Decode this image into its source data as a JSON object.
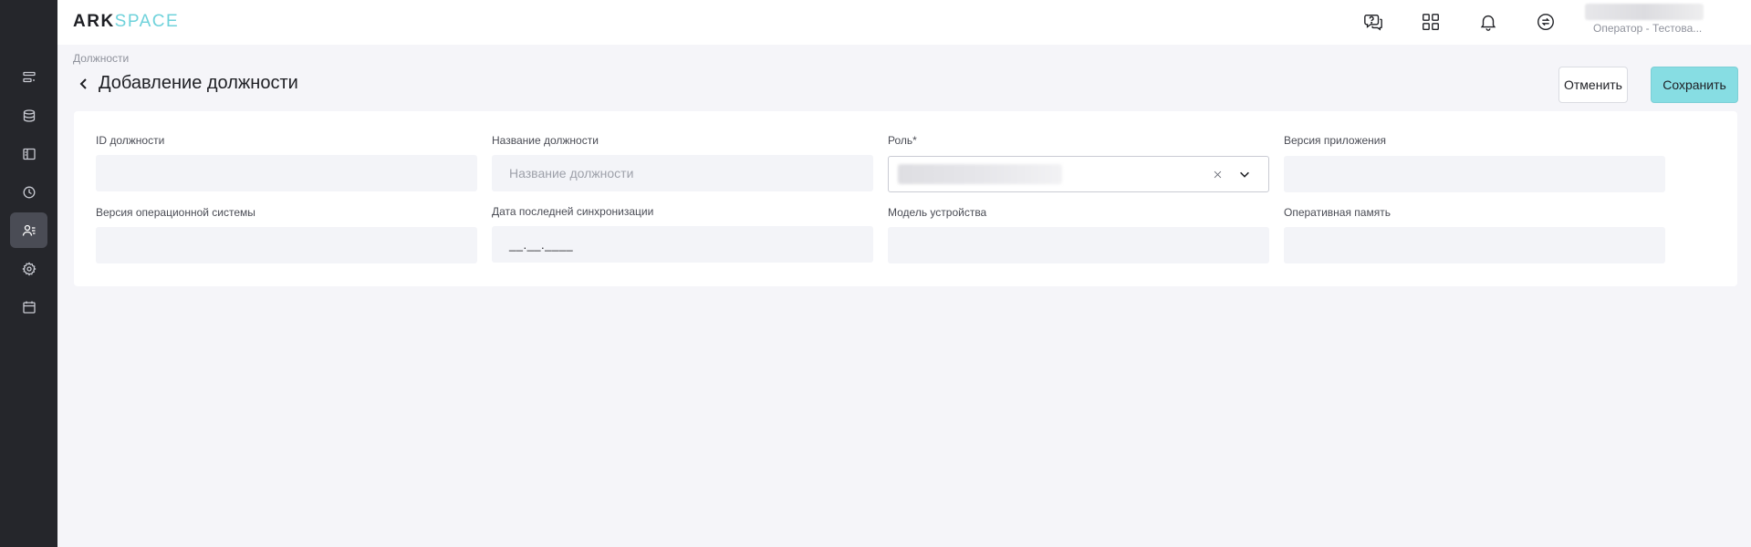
{
  "app": {
    "logo_part1": "ARK",
    "logo_part2": "SPACE"
  },
  "sidebar": {
    "items": [
      {
        "icon": "list-icon"
      },
      {
        "icon": "database-icon"
      },
      {
        "icon": "layout-icon"
      },
      {
        "icon": "clock-icon"
      },
      {
        "icon": "users-icon",
        "active": true
      },
      {
        "icon": "gear-icon"
      },
      {
        "icon": "calendar-icon"
      }
    ]
  },
  "header": {
    "icons": [
      "help-chat-icon",
      "apps-grid-icon",
      "bell-icon",
      "sync-icon"
    ],
    "user_role": "Оператор - Тестова..."
  },
  "breadcrumb": "Должности",
  "page": {
    "title": "Добавление должности",
    "cancel_label": "Отменить",
    "save_label": "Сохранить"
  },
  "form": {
    "fields": [
      {
        "label": "ID должности",
        "value": "",
        "placeholder": ""
      },
      {
        "label": "Название должности",
        "value": "",
        "placeholder": "Название должности"
      },
      {
        "label": "Роль*",
        "type": "select"
      },
      {
        "label": "Версия приложения",
        "value": "",
        "placeholder": ""
      },
      {
        "label": "Версия операционной системы",
        "value": "",
        "placeholder": ""
      },
      {
        "label": "Дата последней синхронизации",
        "value": "__.__.____",
        "placeholder": ""
      },
      {
        "label": "Модель устройства",
        "value": "",
        "placeholder": ""
      },
      {
        "label": "Оперативная память",
        "value": "",
        "placeholder": ""
      }
    ]
  },
  "colors": {
    "sidebar_bg": "#25262b",
    "accent": "#87dde3",
    "logo_accent": "#6fd2db",
    "page_bg": "#f5f5f9"
  }
}
